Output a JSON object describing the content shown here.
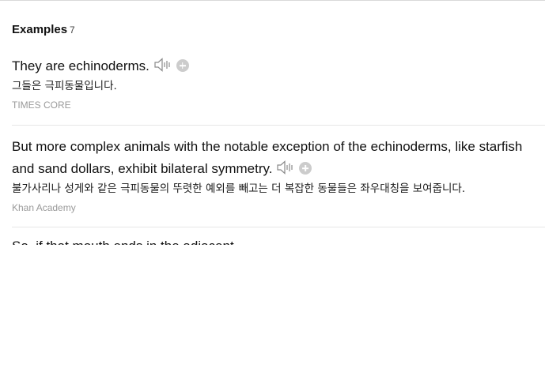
{
  "examples_section": {
    "title": "Examples",
    "count": "7",
    "items": [
      {
        "english": "They are echinoderms.",
        "korean": "그들은 극피동물입니다.",
        "source": "TIMES CORE"
      },
      {
        "english": "But more complex animals with the notable exception of the echinoderms, like starfish and sand dollars, exhibit bilateral symmetry.",
        "korean": "불가사리나 성게와 같은 극피동물의 뚜렷한 예외를 빼고는 더 복잡한 동물들은 좌우대칭을 보여줍니다.",
        "source": "Khan Academy"
      },
      {
        "english": "So, if that mouth ends in the adjacent..."
      }
    ]
  },
  "icons": {
    "speaker": "speaker-icon",
    "add": "plus-circle-icon"
  },
  "colors": {
    "add_button": "#cccccc",
    "speaker_stroke": "#8a8a8a",
    "source_text": "#9a9a9a"
  }
}
